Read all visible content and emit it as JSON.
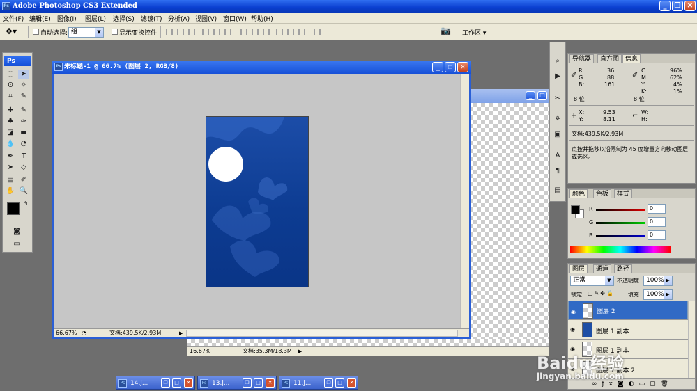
{
  "app": {
    "title": "Adobe Photoshop CS3 Extended"
  },
  "menu": [
    "文件(F)",
    "编辑(E)",
    "图像(I)",
    "图层(L)",
    "选择(S)",
    "滤镜(T)",
    "分析(A)",
    "视图(V)",
    "窗口(W)",
    "帮助(H)"
  ],
  "options": {
    "auto_select_label": "自动选择:",
    "auto_select_value": "组",
    "show_transform_label": "显示变换控件",
    "workspace_label": "工作区 ▾"
  },
  "document": {
    "title": "未标题-1 @ 66.7% (图层 2, RGB/8)",
    "zoom": "66.67%",
    "doc_info": "文档:439.5K/2.93M"
  },
  "back_doc": {
    "zoom": "16.67%",
    "doc_info": "文档:35.3M/18.3M"
  },
  "info_panel": {
    "tabs": [
      "导航器",
      "直方图",
      "信息"
    ],
    "R": "R:",
    "G": "G:",
    "B": "B:",
    "r_val": "36",
    "g_val": "88",
    "b_val": "161",
    "C": "C:",
    "M": "M:",
    "Y": "Y:",
    "K": "K:",
    "c_val": "96%",
    "m_val": "62%",
    "y_val": "4%",
    "k_val": "1%",
    "bit_left": "8 位",
    "bit_right": "8 位",
    "X": "X:",
    "Yc": "Y:",
    "x_val": "9.53",
    "y_val2": "8.11",
    "W": "W:",
    "H": "H:",
    "doc_info": "文档:439.5K/2.93M",
    "hint": "点按并拖移以沿限制为 45 度增量方向移动图层或选区。"
  },
  "color_panel": {
    "tabs": [
      "颜色",
      "色板",
      "样式"
    ],
    "r_label": "R",
    "g_label": "G",
    "b_label": "B",
    "r_val": "0",
    "g_val": "0",
    "b_val": "0"
  },
  "layers_panel": {
    "tabs": [
      "图层",
      "通道",
      "路径"
    ],
    "blend": "正常",
    "opacity_label": "不透明度:",
    "opacity": "100%",
    "lock_label": "锁定:",
    "fill_label": "填充:",
    "fill": "100%",
    "layers": [
      "图层 2",
      "图层 1 副本",
      "图层 1 副本",
      "图层 1 副本 2"
    ]
  },
  "minimized": [
    "14.j...",
    "13.j...",
    "11.j..."
  ],
  "watermark": {
    "brand": "Baidu经验",
    "url": "jingyan.baidu.com"
  }
}
